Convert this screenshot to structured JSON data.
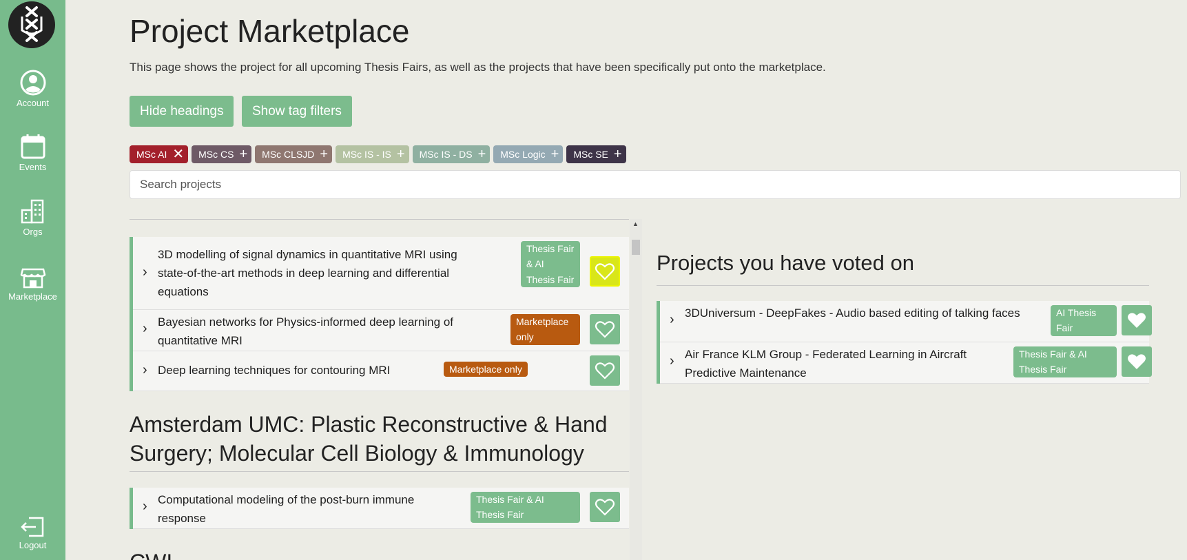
{
  "sidebar": {
    "items": [
      {
        "label": "Account",
        "icon": "account-icon"
      },
      {
        "label": "Events",
        "icon": "calendar-icon"
      },
      {
        "label": "Orgs",
        "icon": "building-icon"
      },
      {
        "label": "Marketplace",
        "icon": "store-icon"
      }
    ],
    "logout": {
      "label": "Logout",
      "icon": "logout-icon"
    }
  },
  "header": {
    "title": "Project Marketplace",
    "description": "This page shows the project for all upcoming Thesis Fairs, as well as the projects that have been specifically put onto the marketplace."
  },
  "buttons": {
    "hide_headings": "Hide headings",
    "show_tag_filters": "Show tag filters"
  },
  "tags": [
    {
      "label": "MSc AI",
      "mark": "✕",
      "color": "#a3202b",
      "active": true
    },
    {
      "label": "MSc CS",
      "mark": "+",
      "color": "#6e5a66",
      "active": false
    },
    {
      "label": "MSc CLSJD",
      "mark": "+",
      "color": "#8f7770",
      "active": false
    },
    {
      "label": "MSc IS - IS",
      "mark": "+",
      "color": "#b4c2a2",
      "active": false
    },
    {
      "label": "MSc IS - DS",
      "mark": "+",
      "color": "#8fb0a1",
      "active": false
    },
    {
      "label": "MSc Logic",
      "mark": "+",
      "color": "#94a9b3",
      "active": false
    },
    {
      "label": "MSc SE",
      "mark": "+",
      "color": "#3e3448",
      "active": false
    }
  ],
  "search": {
    "placeholder": "Search projects",
    "value": ""
  },
  "projects_group_1": [
    {
      "title": "3D modelling of signal dynamics in quantitative MRI using state-of-the-art methods in deep learning and differential equations",
      "badge": "Thesis Fair & AI Thesis Fair",
      "badge_type": "fair",
      "voted": false,
      "highlighted": true
    },
    {
      "title": "Bayesian networks for Physics-informed deep learning of quantitative MRI",
      "badge": "Marketplace only",
      "badge_type": "market",
      "voted": false
    },
    {
      "title": "Deep learning techniques for contouring MRI",
      "badge": "Marketplace only",
      "badge_type": "market",
      "voted": false
    }
  ],
  "section_2": {
    "heading": "Amsterdam UMC: Plastic Reconstructive & Hand Surgery; Molecular Cell Biology & Immunology",
    "projects": [
      {
        "title": "Computational modeling of the post-burn immune response",
        "badge": "Thesis Fair & AI Thesis Fair",
        "badge_type": "fair",
        "voted": false
      }
    ]
  },
  "section_3": {
    "heading": "CWI"
  },
  "voted": {
    "heading": "Projects you have voted on",
    "projects": [
      {
        "title": "3DUniversum - DeepFakes - Audio based editing of talking faces",
        "badge": "AI Thesis Fair",
        "badge_type": "fair",
        "voted": true
      },
      {
        "title": "Air France KLM Group - Federated Learning in Aircraft Predictive Maintenance",
        "badge": "Thesis Fair & AI Thesis Fair",
        "badge_type": "fair",
        "voted": true
      }
    ]
  },
  "colors": {
    "accent": "#78bb8c",
    "button": "#7cbc8d",
    "marketplace_badge": "#b85a10",
    "highlight": "#d9e619"
  }
}
